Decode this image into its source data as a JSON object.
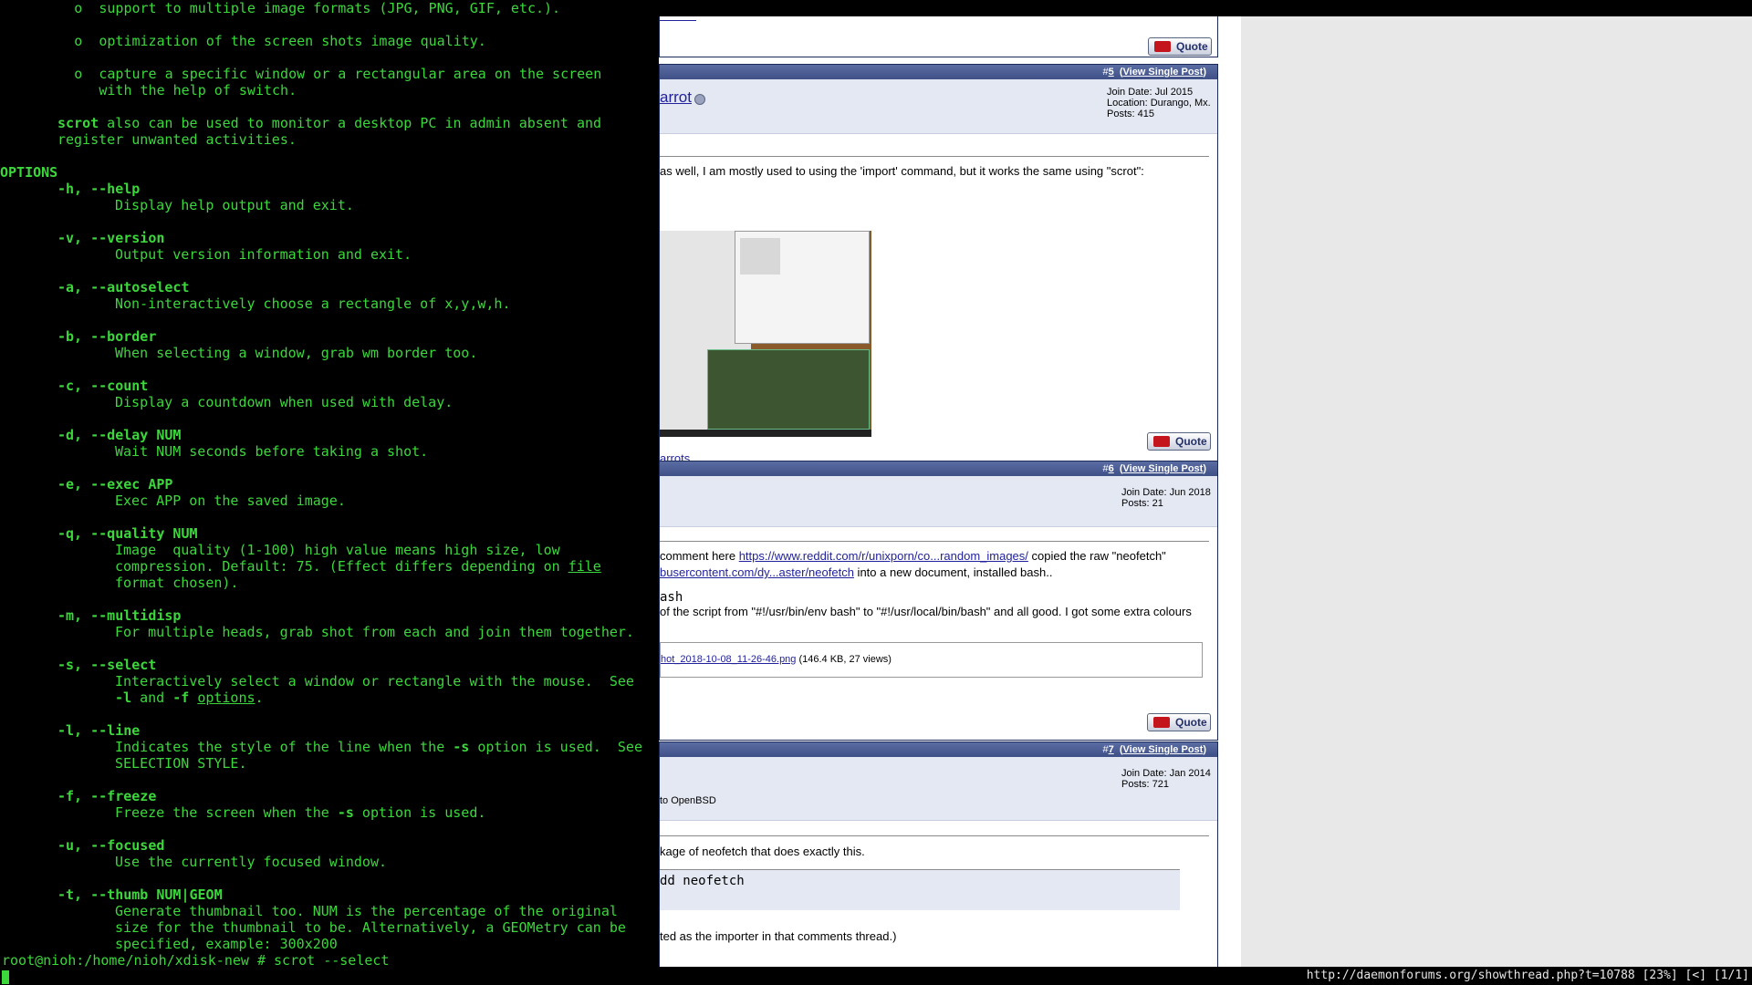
{
  "terminal": {
    "lines": [
      "         o  support to multiple image formats (JPG, PNG, GIF, etc.).",
      "         o  optimization of the screen shots image quality.",
      "         o  capture a specific window or a rectangular area on the screen",
      "            with the help of switch."
    ],
    "para1_b": "scrot",
    "para1_rest": " also can be used to monitor a desktop PC in admin absent and",
    "para1_l2": "register unwanted activities.",
    "options_heading": "OPTIONS",
    "options": [
      {
        "flag": "-h, --help",
        "desc": [
          "Display help output and exit."
        ]
      },
      {
        "flag": "-v, --version",
        "desc": [
          "Output version information and exit."
        ]
      },
      {
        "flag": "-a, --autoselect",
        "desc": [
          "Non-interactively choose a rectangle of x,y,w,h."
        ]
      },
      {
        "flag": "-b, --border",
        "desc": [
          "When selecting a window, grab wm border too."
        ]
      },
      {
        "flag": "-c, --count",
        "desc": [
          "Display a countdown when used with delay."
        ]
      },
      {
        "flag": "-d, --delay NUM",
        "desc": [
          "Wait NUM seconds before taking a shot."
        ]
      },
      {
        "flag": "-e, --exec APP",
        "desc": [
          "Exec APP on the saved image."
        ]
      },
      {
        "flag": "-q, --quality NUM",
        "desc": [
          "Image  quality (1-100) high value means high size, low",
          "compression. Default: 75. (Effect differs depending on ",
          "format chosen)."
        ]
      },
      {
        "flag": "-m, --multidisp",
        "desc": [
          "For multiple heads, grab shot from each and join them together."
        ]
      },
      {
        "flag": "-s, --select",
        "desc": [
          "Interactively select a window or rectangle with the mouse.  See"
        ]
      },
      {
        "flag": "-l, --line",
        "desc": [
          "Indicates the style of the line when the ",
          "SELECTION STYLE."
        ]
      },
      {
        "flag": "-f, --freeze",
        "desc": [
          "Freeze the screen when the "
        ]
      },
      {
        "flag": "-u, --focused",
        "desc": [
          "Use the currently focused window."
        ]
      },
      {
        "flag": "-t, --thumb NUM|GEOM",
        "desc": [
          "Generate thumbnail too. NUM is the percentage of the original",
          "size for the thumbnail to be. Alternatively, a GEOMetry can be",
          "specified, example: 300x200"
        ]
      }
    ],
    "file_word": "file",
    "select_l2_a": "-l",
    "select_l2_and": " and ",
    "select_l2_f": "-f",
    "options_link": "options",
    "dot": ".",
    "line_s": "-s",
    "line_rest": " option is used.  See",
    "freeze_s": "-s",
    "freeze_rest": " option is used.",
    "prompt": "root@nioh:/home/nioh/xdisk-new # scrot --select"
  },
  "browser": {
    "post5": {
      "hash": "#",
      "num": "5",
      "view": "View Single Post",
      "username": "arrot",
      "join": "Join Date: Jul 2015",
      "location": "Location: Durango, Mx.",
      "posts": "Posts: 415",
      "text": "as well, I am mostly used to using the 'import' command, but it works the same using \"scrot\":",
      "sig_link": "arrots",
      "quote": "Quote"
    },
    "post6": {
      "hash": "#",
      "num": "6",
      "view": "View Single Post",
      "join": "Join Date: Jun 2018",
      "posts": "Posts: 21",
      "text1_a": " comment here ",
      "text1_link": "https://www.reddit.com/r/unixporn/co...random_images/",
      "text1_b": " copied the raw \"neofetch\"",
      "text2_link": "busercontent.com/dy...aster/neofetch",
      "text2_b": " into a new document, installed bash..",
      "code": "ash",
      "text3": " of the script from \"#!/usr/bin/env bash\" to \"#!/usr/local/bin/bash\" and all good. I got some extra colours",
      "attach_link": "hot_2018-10-08_11-26-46.png",
      "attach_meta": " (146.4 KB, 27 views)",
      "quote": "Quote"
    },
    "post7": {
      "hash": "#",
      "num": "7",
      "view": "View Single Post",
      "join": "Join Date: Jan 2014",
      "posts": "Posts: 721",
      "sub": " to OpenBSD",
      "text1": "kage of neofetch that does exactly this.",
      "code": "dd neofetch",
      "text2": "ted as the importer in that comments thread.)"
    },
    "top_quote": "Quote"
  },
  "status": {
    "url": "http://daemonforums.org/showthread.php?t=10788 [23%] [<] [1/1]"
  },
  "colors": {
    "terminal_fg": "#3bd73b",
    "terminal_bg": "#000000",
    "forum_header": "#3f5087",
    "link": "#22229c"
  }
}
